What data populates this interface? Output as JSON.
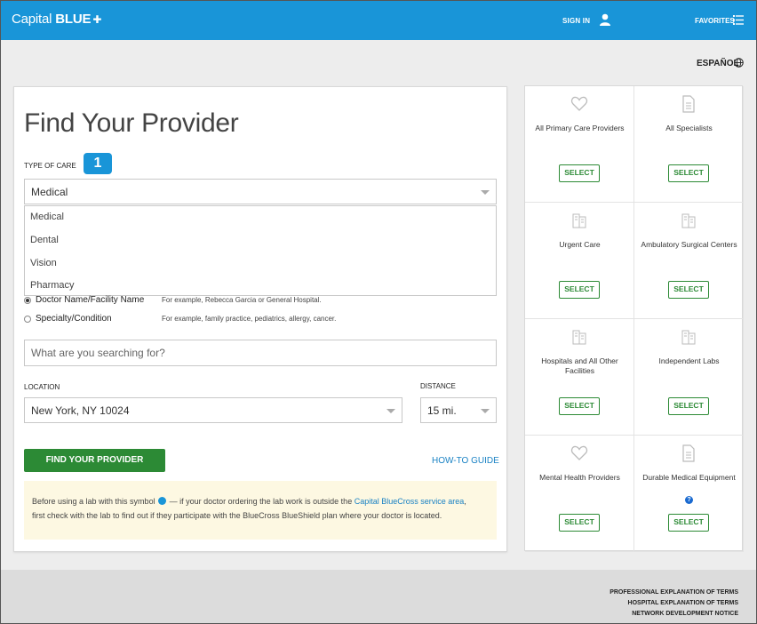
{
  "header": {
    "logo_text": "Capital ",
    "logo_bold": "BLUE",
    "logo_cross": "✚",
    "sign_in": "SIGN IN",
    "favorites": "FAVORITES",
    "color": "#1995d8"
  },
  "language": {
    "label": "ESPAÑOL"
  },
  "search": {
    "title": "Find Your Provider",
    "type_of_care_label": "TYPE OF CARE",
    "step_badge": "1",
    "type_of_care_value": "Medical",
    "type_of_care_options": [
      "Medical",
      "Dental",
      "Vision",
      "Pharmacy"
    ],
    "search_by": [
      {
        "label": "Doctor Name/Facility Name",
        "example": "For example, Rebecca Garcia or General Hospital.",
        "selected": true
      },
      {
        "label": "Specialty/Condition",
        "example": "For example, family practice, pediatrics, allergy, cancer.",
        "selected": false
      }
    ],
    "query_placeholder": "What are you searching for?",
    "location_label": "LOCATION",
    "location_value": "New York, NY 10024",
    "distance_label": "DISTANCE",
    "distance_value": "15 mi.",
    "submit_label": "FIND YOUR PROVIDER",
    "howto_label": "HOW-TO GUIDE"
  },
  "notice": {
    "text_before": "Before using a lab with this symbol",
    "text_middle": " — if your doctor ordering the lab work is outside the ",
    "link": "Capital BlueCross service area",
    "text_after": ",",
    "line2": "first check with the lab to find out if they participate with the BlueCross BlueShield plan where your doctor is located."
  },
  "categories": [
    {
      "label": "All Primary Care Providers",
      "icon": "heart-icon",
      "button": "SELECT"
    },
    {
      "label": "All Specialists",
      "icon": "document-icon",
      "button": "SELECT"
    },
    {
      "label": "Urgent Care",
      "icon": "building-icon",
      "button": "SELECT"
    },
    {
      "label": "Ambulatory Surgical Centers",
      "icon": "building-icon",
      "button": "SELECT"
    },
    {
      "label": "Hospitals and All Other Facilities",
      "icon": "building-icon",
      "button": "SELECT"
    },
    {
      "label": "Independent Labs",
      "icon": "building-icon",
      "button": "SELECT"
    },
    {
      "label": "Mental Health Providers",
      "icon": "heart-icon",
      "button": "SELECT"
    },
    {
      "label": "Durable Medical Equipment",
      "icon": "document-icon",
      "button": "SELECT",
      "help": "?"
    }
  ],
  "footer": {
    "links": [
      "PROFESSIONAL EXPLANATION OF TERMS",
      "HOSPITAL EXPLANATION OF TERMS",
      "NETWORK DEVELOPMENT NOTICE"
    ]
  },
  "colors": {
    "brand_blue": "#1995d8",
    "action_green": "#2c8a35",
    "link_blue": "#1a82c4",
    "notice_bg": "#fdf8e2"
  }
}
